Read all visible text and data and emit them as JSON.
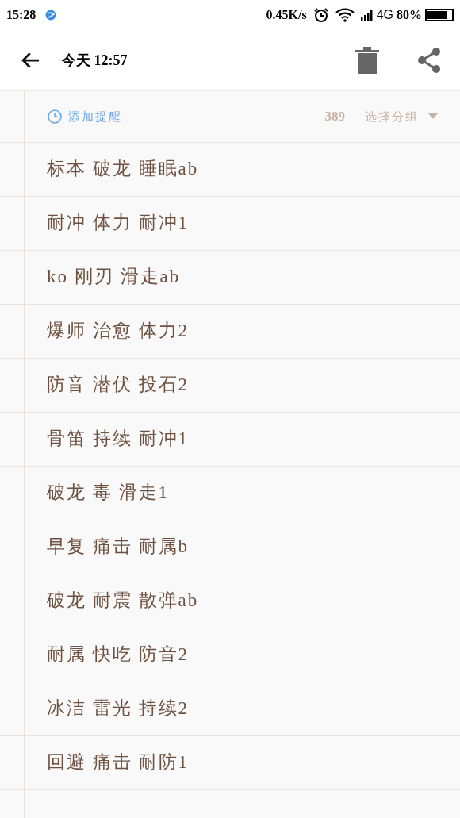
{
  "status_bar": {
    "time": "15:28",
    "speed": "0.45K/s",
    "network": "4G",
    "battery": "80%"
  },
  "toolbar": {
    "title": "今天 12:57"
  },
  "header": {
    "reminder": "添加提醒",
    "count": "389",
    "group": "选择分组"
  },
  "lines": [
    "标本 破龙 睡眠ab",
    "耐冲 体力 耐冲1",
    "ko 刚刃 滑走ab",
    "爆师 治愈 体力2",
    "防音 潜伏 投石2",
    "骨笛 持续 耐冲1",
    "破龙 毒 滑走1",
    "早复 痛击 耐属b",
    "破龙 耐震 散弹ab",
    "耐属 快吃 防音2",
    "冰洁 雷光 持续2",
    "回避 痛击 耐防1"
  ]
}
